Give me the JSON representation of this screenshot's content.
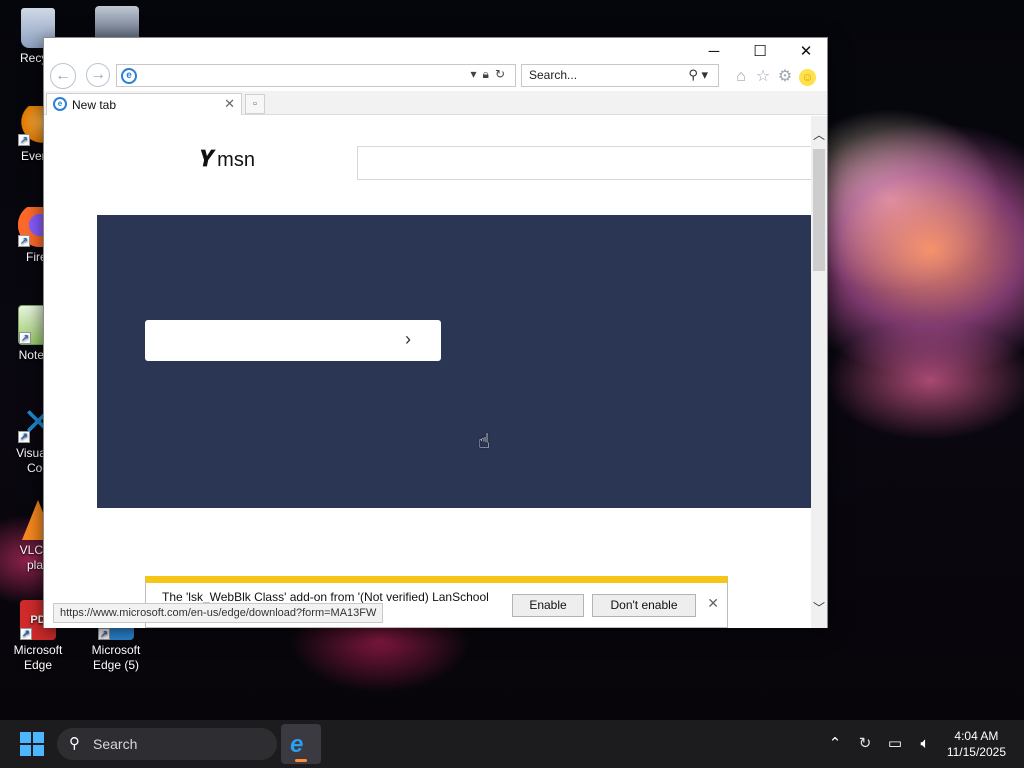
{
  "desktop": {
    "icons": [
      {
        "label": "Recycl",
        "icon": "recycle-bin-icon"
      },
      {
        "label": "Everyt",
        "icon": "everything-search-icon"
      },
      {
        "label": "Firef",
        "icon": "firefox-icon"
      },
      {
        "label": "Notepa",
        "icon": "notepad-icon"
      },
      {
        "label": "Visual S Cod",
        "icon": "vscode-icon"
      },
      {
        "label": "VLC m play",
        "icon": "vlc-icon"
      },
      {
        "label": "Microsoft Edge",
        "icon": "pdf-edge-icon"
      },
      {
        "label": "Microsoft Edge (5)",
        "icon": "edge-icon"
      }
    ]
  },
  "browser": {
    "address_value": "",
    "search_placeholder": "Search...",
    "tab_label": "New tab",
    "window_controls": {
      "minimize": "─",
      "maximize": "☐",
      "close": "✕"
    },
    "page": {
      "logo_text": "msn",
      "hero_color": "#2a3654"
    },
    "status_url": "https://www.microsoft.com/en-us/edge/download?form=MA13FW",
    "notification": {
      "message": "The 'lsk_WebBlk Class' add-on from '(Not verified) LanSchool",
      "enable_label": "Enable",
      "dont_enable_label": "Don't enable"
    }
  },
  "taskbar": {
    "search_label": "Search",
    "time": "4:04 AM",
    "date": "11/15/2025"
  },
  "colors": {
    "accent_blue": "#2a7fd6",
    "notification_bar": "#f5c518",
    "hero_background": "#2a3654"
  }
}
